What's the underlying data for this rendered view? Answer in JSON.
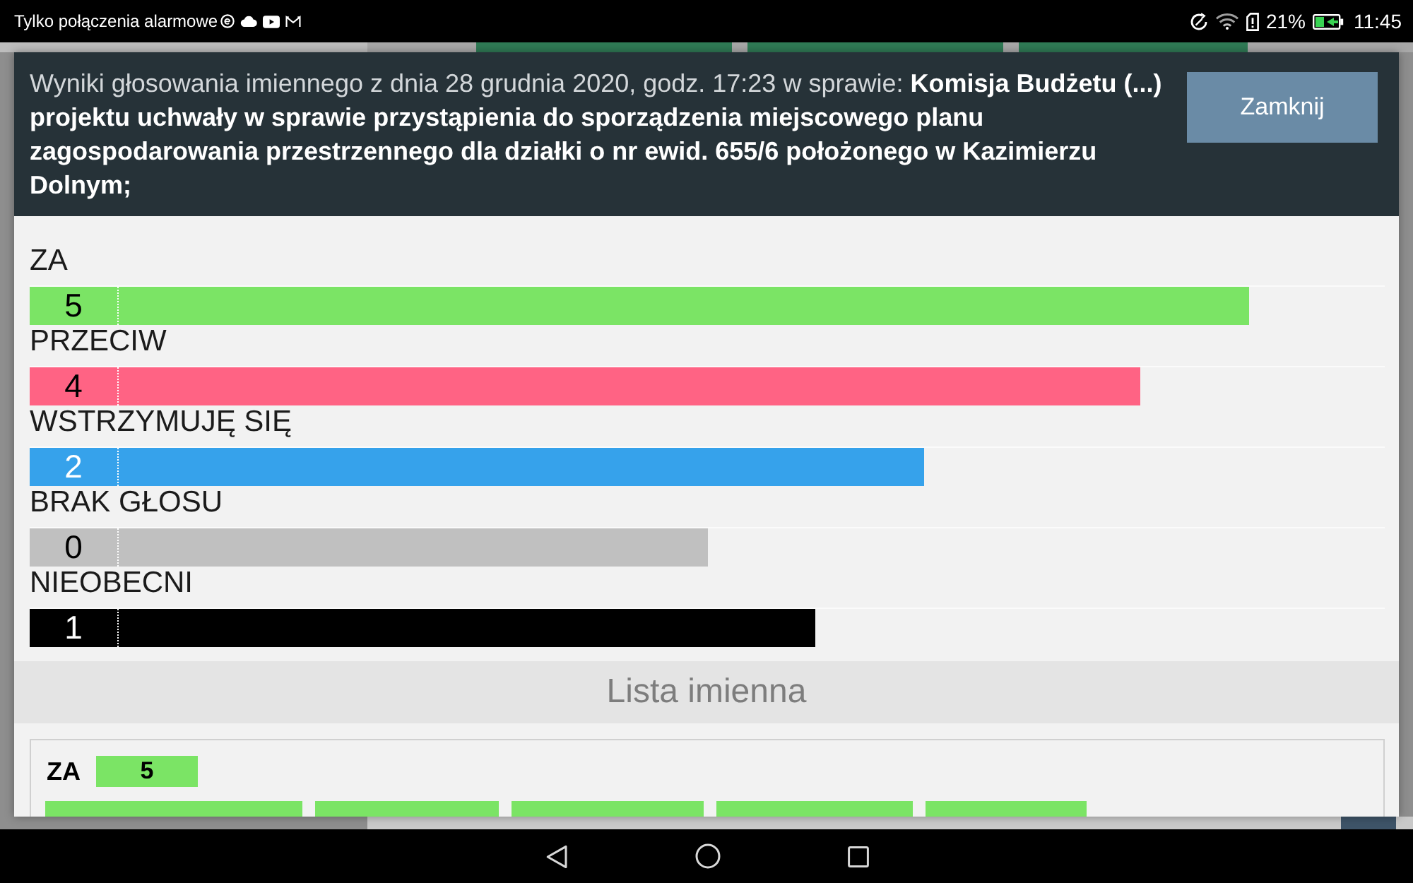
{
  "status_bar": {
    "carrier": "Tylko połączenia alarmowe",
    "battery": "21%",
    "time": "11:45"
  },
  "dialog": {
    "title": "Wyniki głosowania imiennego z dnia 28 grudnia 2020, godz. 17:23 w sprawie: **Komisja Budżetu (...) projektu uchwały w sprawie przystąpienia do sporządzenia miejscowego planu zagospodarowania przestrzennego dla działki o nr ewid. 655/6 położonego w Kazimierzu Dolnym;**",
    "close_button": "Zamknij",
    "results": [
      {
        "label": "ZA",
        "count": "5",
        "color": "#7be465",
        "level": 0.9
      },
      {
        "label": "PRZECIW",
        "count": "4",
        "color": "#ff6384",
        "level": 0.82
      },
      {
        "label": "WSTRZYMUJĘ SIĘ",
        "count": "2",
        "color": "#36a2eb",
        "level": 0.66
      },
      {
        "label": "BRAK GŁOSU",
        "count": "0",
        "color": "#c0c0c0",
        "level": 0.5
      },
      {
        "label": "NIEOBECNI",
        "count": "1",
        "color": "#000000",
        "level": 0.58
      }
    ],
    "list_heading": "Lista imienna",
    "groups": [
      {
        "label": "ZA",
        "count": "5",
        "color": "#7be465"
      }
    ]
  }
}
